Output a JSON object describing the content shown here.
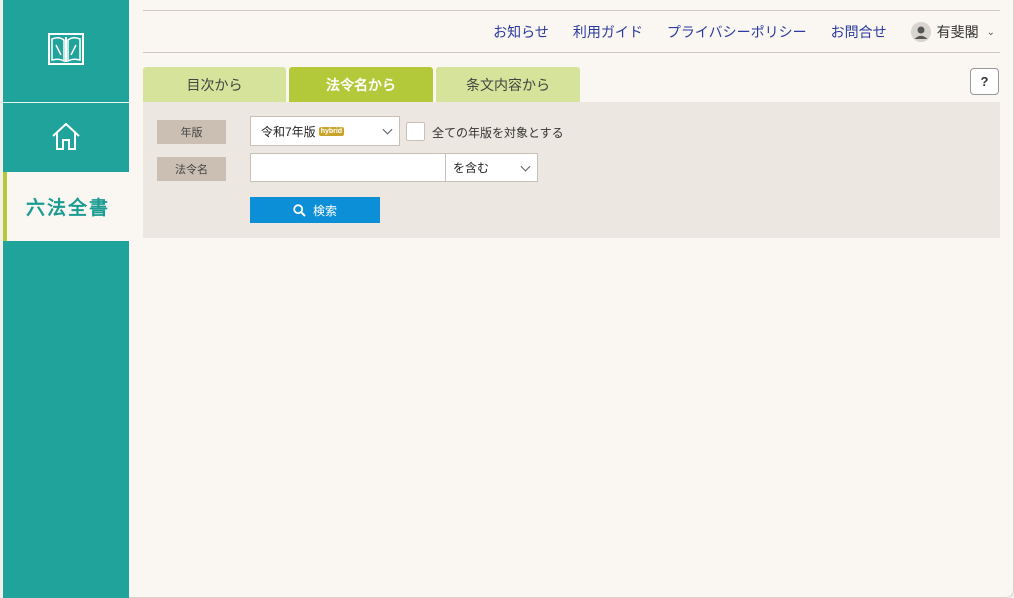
{
  "sidebar": {
    "logo_icon": "book-logo-icon",
    "home_icon": "home-icon",
    "roppo_label": "六法全書"
  },
  "topnav": {
    "links": [
      {
        "label": "お知らせ"
      },
      {
        "label": "利用ガイド"
      },
      {
        "label": "プライバシーポリシー"
      },
      {
        "label": "お問合せ"
      }
    ],
    "user": {
      "name": "有斐閣",
      "icon": "user-avatar-icon"
    }
  },
  "tabs": [
    {
      "label": "目次から",
      "active": false
    },
    {
      "label": "法令名から",
      "active": true
    },
    {
      "label": "条文内容から",
      "active": false
    }
  ],
  "help_label": "?",
  "search": {
    "edition_label": "年版",
    "edition_value": "令和7年版",
    "edition_badge": "hybrid",
    "all_editions_label": "全ての年版を対象とする",
    "law_name_label": "法令名",
    "law_name_value": "",
    "match_value": "を含む",
    "button_label": "検索"
  },
  "colors": {
    "sidebar": "#20a39a",
    "tab_active": "#b4c93a",
    "tab_inactive": "#d6e39a",
    "link": "#2b3a9c",
    "button": "#0c8fd6"
  }
}
